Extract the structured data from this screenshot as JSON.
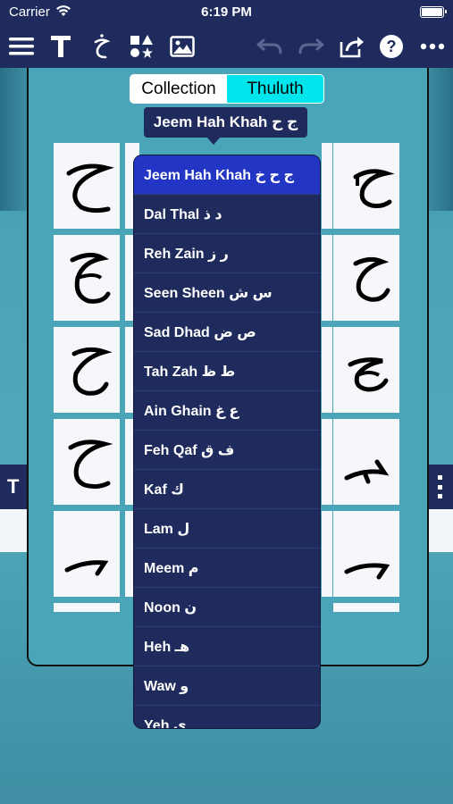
{
  "status_bar": {
    "carrier": "Carrier",
    "time": "6:19 PM"
  },
  "toolbar": {
    "icons": [
      "menu-icon",
      "text-icon",
      "arabic-letter-icon",
      "shapes-icon",
      "image-icon",
      "undo-icon",
      "redo-icon",
      "share-icon",
      "help-icon",
      "more-icon"
    ],
    "help_label": "?"
  },
  "segmented": {
    "options": [
      "Collection",
      "Thuluth"
    ],
    "selected": "Thuluth"
  },
  "popup": {
    "label": "Jeem Hah Khah ج ح"
  },
  "dropdown": {
    "items": [
      "Jeem Hah Khah ج ح خ",
      "Dal Thal د ذ",
      "Reh Zain ر ز",
      "Seen Sheen س ش",
      "Sad Dhad ص ض",
      "Tah Zah ط ظ",
      "Ain Ghain ع غ",
      "Feh Qaf ف ق",
      "Kaf ك",
      "Lam ل",
      "Meem م",
      "Noon ن",
      "Heh هـ",
      "Waw و",
      "Yeh ى"
    ],
    "selected_index": 0
  },
  "colors": {
    "bar": "#1e2b5c",
    "accent": "#00e5ec",
    "selected_item": "#2235c4",
    "panel": "#4aa5b8"
  }
}
